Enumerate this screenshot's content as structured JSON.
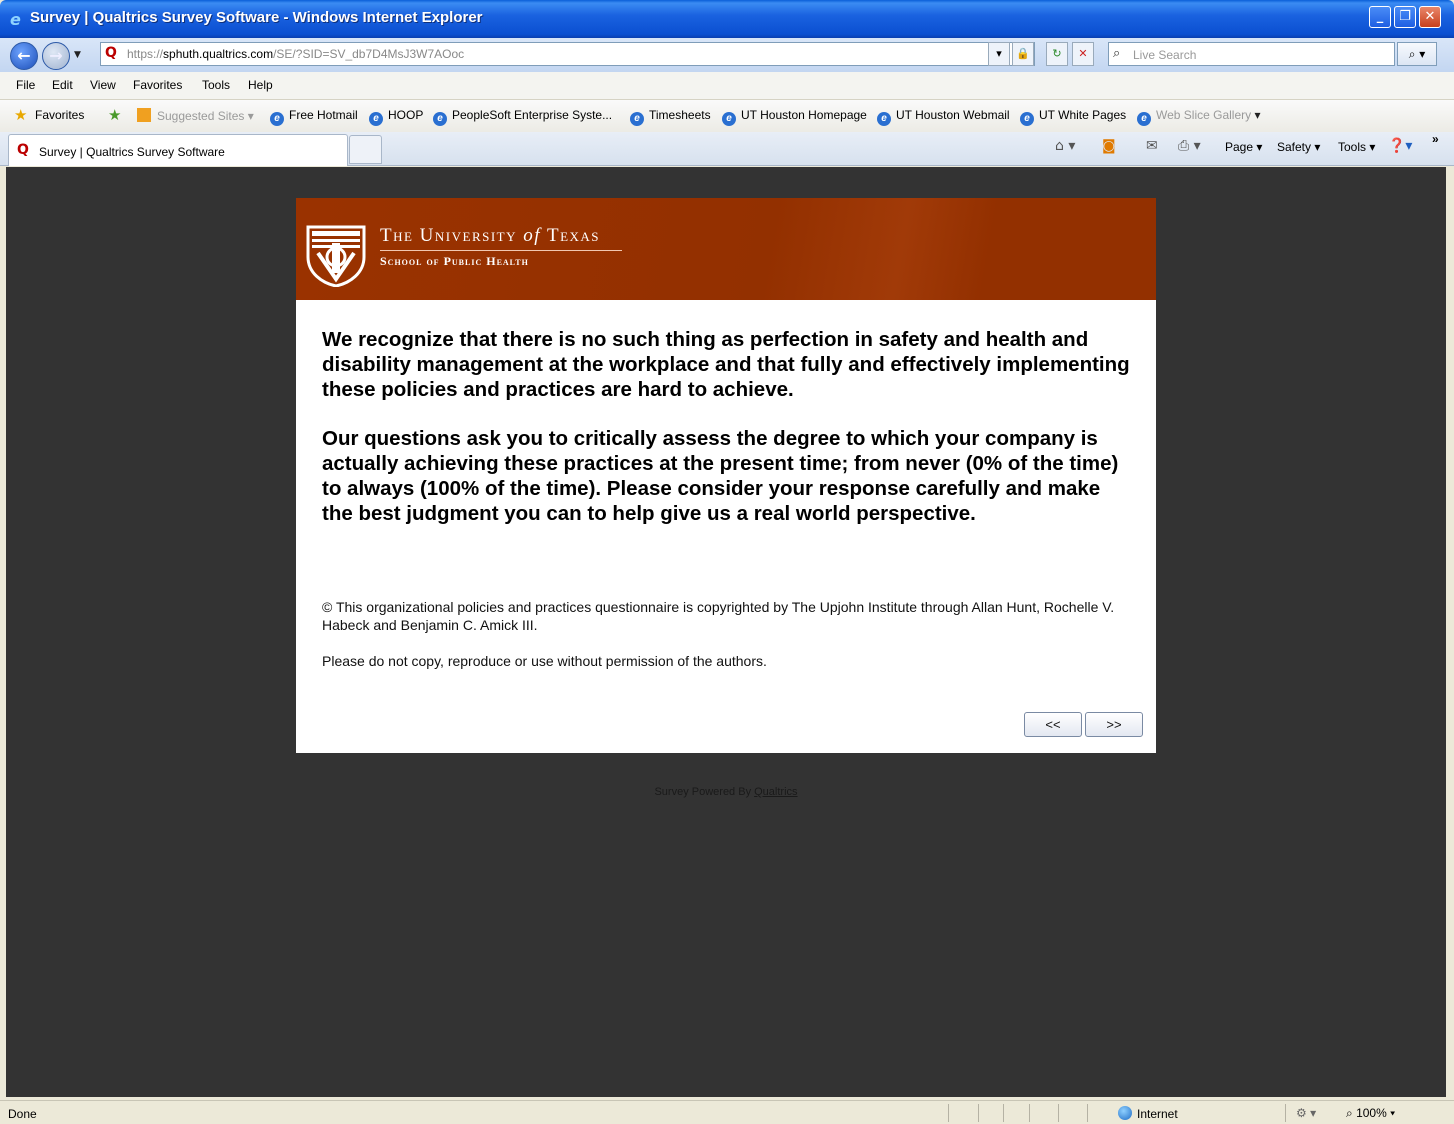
{
  "window": {
    "title": "Survey | Qualtrics Survey Software - Windows Internet Explorer"
  },
  "address": {
    "url_scheme": "https://",
    "url_host": "sphuth.qualtrics.com",
    "url_path": "/SE/?SID=SV_db7D4MsJ3W7AOoc",
    "search_placeholder": "Live Search"
  },
  "menu": [
    "File",
    "Edit",
    "View",
    "Favorites",
    "Tools",
    "Help"
  ],
  "favorites": {
    "label": "Favorites",
    "suggested": "Suggested Sites",
    "links": [
      "Free Hotmail",
      "HOOP",
      "PeopleSoft Enterprise Syste...",
      "Timesheets",
      "UT Houston Homepage",
      "UT Houston Webmail",
      "UT White Pages"
    ],
    "web_slice": "Web Slice Gallery"
  },
  "tab": {
    "label": "Survey | Qualtrics Survey Software"
  },
  "commands": {
    "page": "Page",
    "safety": "Safety",
    "tools": "Tools",
    "chevron": "»"
  },
  "banner": {
    "line1_a": "The University",
    "line1_of": "of",
    "line1_b": "Texas",
    "line2": "School of Public Health"
  },
  "survey": {
    "paragraph1": "We recognize that there is no such thing as perfection in safety and health and disability management at the workplace and that fully and effectively implementing these policies and practices are hard to achieve.",
    "paragraph2": "Our questions ask you to critically assess the degree to which your company is actually achieving these practices at the present time; from never (0% of the time) to always (100% of the time). Please consider your response carefully and make the best judgment you can to help give us a real world perspective.",
    "copyright": "© This organizational policies and practices questionnaire is copyrighted by The Upjohn Institute through Allan Hunt, Rochelle V. Habeck and Benjamin C. Amick III.",
    "permission": "Please do not copy, reproduce or use without permission of the authors.",
    "prev_label": "<<",
    "next_label": ">>"
  },
  "footer": {
    "powered_text": "Survey Powered By ",
    "powered_link": "Qualtrics"
  },
  "status": {
    "text": "Done",
    "zone": "Internet",
    "zoom": "100%"
  },
  "colors": {
    "banner": "#933000",
    "page_background": "#333333",
    "titlebar": "#0b4fd1"
  }
}
